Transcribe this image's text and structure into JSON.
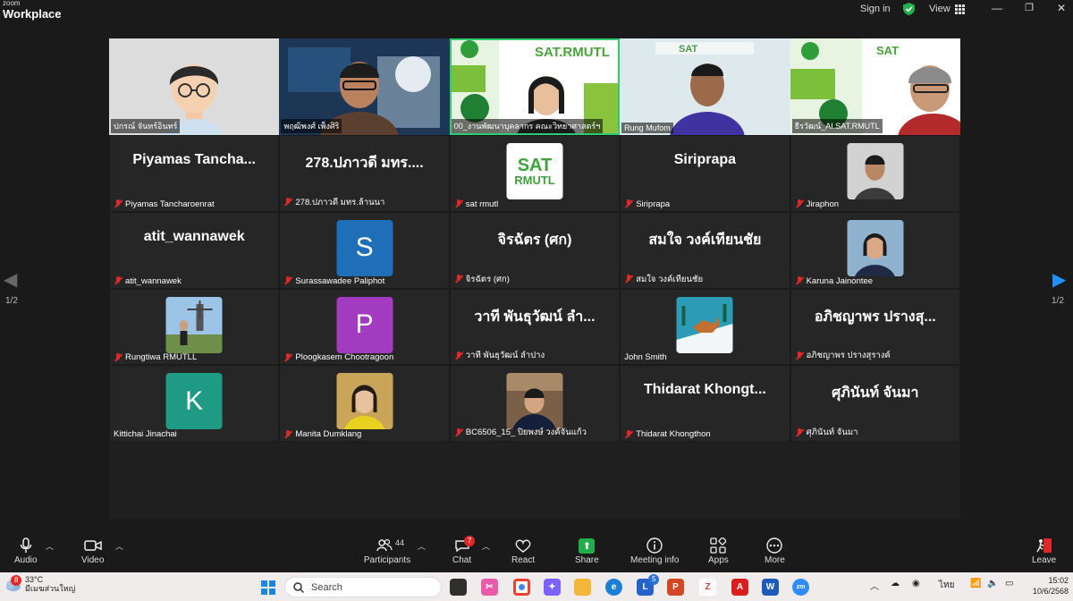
{
  "app": {
    "brand_top": "zoom",
    "brand_main": "Workplace"
  },
  "titlebar": {
    "signin": "Sign in",
    "view": "View"
  },
  "speakers": [
    {
      "name": "ปกรณ์ จันทร์อินทร์",
      "active": false
    },
    {
      "name": "พฤฒิพงศ์ เพ็งศิริ",
      "active": false
    },
    {
      "name": "00_งานพัฒนาบุคลากร คณะวิทยาศาสตร์ฯ",
      "active": true
    },
    {
      "name": "Rung Mufom",
      "active": false
    },
    {
      "name": "ธีรวัฒน์_AI.SAT.RMUTL",
      "active": false
    }
  ],
  "participants": [
    {
      "display": "Piyamas  Tancha...",
      "label": "Piyamas Tancharoenrat",
      "type": "text"
    },
    {
      "display": "278.ปภาวดี มทร....",
      "label": "278.ปภาวดี มทร.ล้านนา",
      "type": "text"
    },
    {
      "display": "SAT RMUTL",
      "label": "sat rmutl",
      "type": "logo"
    },
    {
      "display": "Siriprapa",
      "label": "Siriprapa",
      "type": "text"
    },
    {
      "display": "",
      "label": "Jiraphon",
      "type": "photo",
      "color": "#c9c9c9"
    },
    {
      "display": "atit_wannawek",
      "label": "atit_wannawek",
      "type": "text"
    },
    {
      "display": "S",
      "label": "Surassawadee Paliphot",
      "type": "letter",
      "color": "#1f6fb8"
    },
    {
      "display": "จิรฉัตร (ศก)",
      "label": "จิรฉัตร (ศก)",
      "type": "text"
    },
    {
      "display": "สมใจ วงค์เทียนชัย",
      "label": "สมใจ วงค์เทียนชัย",
      "type": "text"
    },
    {
      "display": "",
      "label": "Karuna Jainontee",
      "type": "photo",
      "color": "#7ba4c4"
    },
    {
      "display": "",
      "label": "Rungtiwa RMUTLL",
      "type": "photo",
      "color": "#8cb5d9"
    },
    {
      "display": "P",
      "label": "Ploogkasem Chootragoon",
      "type": "letter",
      "color": "#a23bbf"
    },
    {
      "display": "วาที พันธุวัฒน์ ลำ...",
      "label": "วาที พันธุวัฒน์ ลำปาง",
      "type": "text"
    },
    {
      "display": "",
      "label": "John Smith",
      "type": "photo",
      "color": "#2aa3b8",
      "muted": false
    },
    {
      "display": "อภิชญาพร ปรางสุ...",
      "label": "อภิชญาพร ปรางสุรางค์",
      "type": "text"
    },
    {
      "display": "K",
      "label": "Kittichai Jinachai",
      "type": "letter",
      "color": "#1f9a85",
      "muted": false
    },
    {
      "display": "",
      "label": "Manita Dumklang",
      "type": "photo",
      "color": "#e0b84a"
    },
    {
      "display": "",
      "label": "BC6506_15_ ปิยพงษ์ วงค์จันแก้ว",
      "type": "photo",
      "color": "#8a6a4a"
    },
    {
      "display": "Thidarat  Khongt...",
      "label": "Thidarat Khongthon",
      "type": "text"
    },
    {
      "display": "ศุภินันท์ จันมา",
      "label": "ศุภินันท์ จันมา",
      "type": "text"
    }
  ],
  "pager": {
    "left": "1/2",
    "right": "1/2"
  },
  "toolbar": {
    "audio": "Audio",
    "video": "Video",
    "participants": "Participants",
    "participants_count": "44",
    "chat": "Chat",
    "chat_badge": "7",
    "react": "React",
    "share": "Share",
    "meeting_info": "Meeting info",
    "apps": "Apps",
    "more": "More",
    "leave": "Leave"
  },
  "taskbar": {
    "weather_badge": "8",
    "temp": "33°C",
    "weather_loc": "มีเมฆส่วนใหญ่",
    "search": "Search",
    "lang": "ไทย",
    "time": "15:02",
    "date": "10/6/2568",
    "outlook_badge": "5"
  },
  "colors": {
    "active_border": "#2ecc71",
    "muted_mic": "#e02828",
    "share_green": "#1fae4a",
    "pager_blue": "#1e90ff"
  }
}
